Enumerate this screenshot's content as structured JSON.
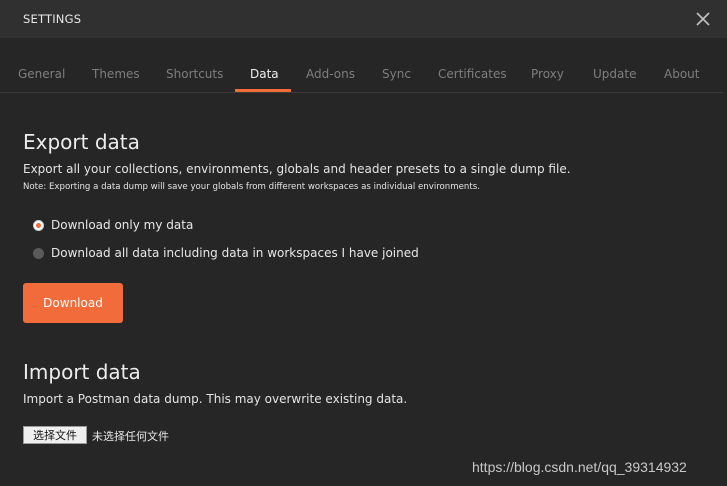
{
  "window": {
    "title": "SETTINGS",
    "close_icon": "close-icon"
  },
  "tabs": [
    {
      "label": "General",
      "active": false
    },
    {
      "label": "Themes",
      "active": false
    },
    {
      "label": "Shortcuts",
      "active": false
    },
    {
      "label": "Data",
      "active": true
    },
    {
      "label": "Add-ons",
      "active": false
    },
    {
      "label": "Sync",
      "active": false
    },
    {
      "label": "Certificates",
      "active": false
    },
    {
      "label": "Proxy",
      "active": false
    },
    {
      "label": "Update",
      "active": false
    },
    {
      "label": "About",
      "active": false
    }
  ],
  "export": {
    "heading": "Export data",
    "description": "Export all your collections, environments, globals and header presets to a single dump file.",
    "note": "Note: Exporting a data dump will save your globals from different workspaces as individual environments.",
    "options": [
      {
        "label": "Download only my data",
        "checked": true
      },
      {
        "label": "Download all data including data in workspaces I have joined",
        "checked": false
      }
    ],
    "download_label": "Download"
  },
  "import": {
    "heading": "Import data",
    "description": "Import a Postman data dump. This may overwrite existing data.",
    "file_button_label": "选择文件",
    "file_status": "未选择任何文件"
  },
  "watermark": "https://blog.csdn.net/qq_39314932",
  "colors": {
    "accent": "#f26b3a",
    "background": "#262626",
    "titlebar": "#303030"
  }
}
